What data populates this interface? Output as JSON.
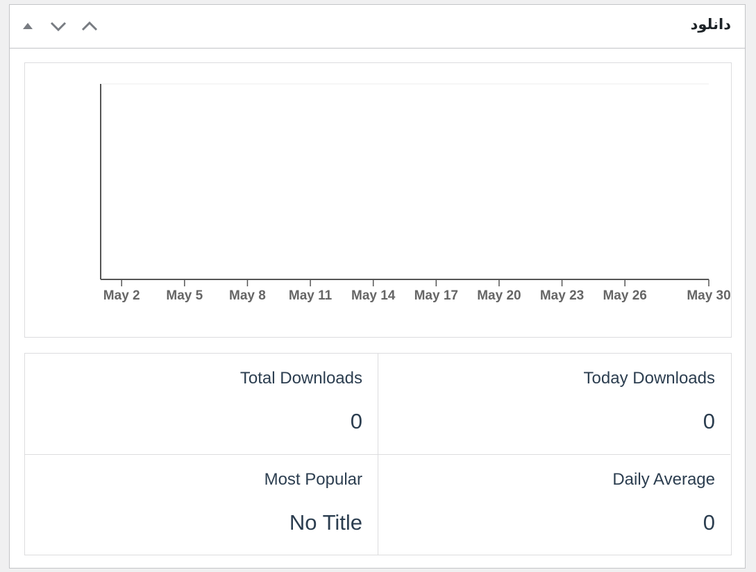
{
  "widget": {
    "title": "دانلود",
    "controls": [
      {
        "icon": "triangle-up-icon"
      },
      {
        "icon": "chevron-down-icon"
      },
      {
        "icon": "chevron-up-icon"
      }
    ]
  },
  "chart_data": {
    "type": "line",
    "title": "",
    "xlabel": "",
    "ylabel": "",
    "categories": [
      "May 2",
      "May 5",
      "May 8",
      "May 11",
      "May 14",
      "May 17",
      "May 20",
      "May 23",
      "May 26",
      "May 30"
    ],
    "series": [],
    "grid": false,
    "colors": {
      "axis": "#555555",
      "tick_label": "#666666"
    }
  },
  "stats": {
    "total_downloads": {
      "label": "Total Downloads",
      "value": "0"
    },
    "today_downloads": {
      "label": "Today Downloads",
      "value": "0"
    },
    "most_popular": {
      "label": "Most Popular",
      "value": "No Title"
    },
    "daily_average": {
      "label": "Daily Average",
      "value": "0"
    }
  },
  "colors": {
    "text": "#2c3e50",
    "border": "#dcdcde",
    "background": "#f0f0f1"
  }
}
